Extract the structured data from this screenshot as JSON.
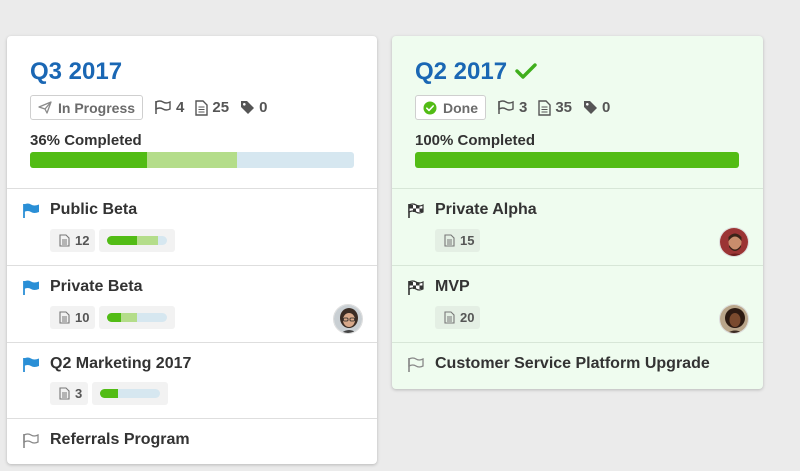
{
  "colors": {
    "title_blue": "#1a67b4",
    "progress_green": "#52bc15",
    "progress_partial": "#b4dd8a",
    "progress_track": "#d6e7f0",
    "flag_blue": "#2a8fd6",
    "done_card_bg": "#effcef"
  },
  "q3": {
    "title": "Q3 2017",
    "status_label": "In Progress",
    "status_icon": "paper-plane-icon",
    "milestones": "4",
    "documents": "25",
    "tags": "0",
    "completed_label": "36% Completed",
    "progress_done": 0.36,
    "progress_partial": 0.28,
    "items": [
      {
        "title": "Public Beta",
        "flag": "flag-filled-blue-icon",
        "docs": "12",
        "progress_done": 0.5,
        "progress_partial": 0.35
      },
      {
        "title": "Private Beta",
        "flag": "flag-filled-blue-icon",
        "docs": "10",
        "progress_done": 0.22,
        "progress_partial": 0.28,
        "avatar": "avatar-woman-glasses"
      },
      {
        "title": "Q2 Marketing 2017",
        "flag": "flag-filled-blue-icon",
        "docs": "3",
        "progress_done": 0.3,
        "progress_partial": 0
      },
      {
        "title": "Referrals Program",
        "flag": "flag-outline-icon"
      }
    ]
  },
  "q2": {
    "title": "Q2 2017",
    "status_label": "Done",
    "status_icon": "check-circle-icon",
    "milestones": "3",
    "documents": "35",
    "tags": "0",
    "completed_label": "100% Completed",
    "progress_done": 1.0,
    "items": [
      {
        "title": "Private Alpha",
        "flag": "flag-checkered-icon",
        "docs": "15",
        "avatar": "avatar-man-beard"
      },
      {
        "title": "MVP",
        "flag": "flag-checkered-icon",
        "docs": "20",
        "avatar": "avatar-woman-curly"
      },
      {
        "title": "Customer Service Platform Upgrade",
        "flag": "flag-outline-icon"
      }
    ]
  }
}
